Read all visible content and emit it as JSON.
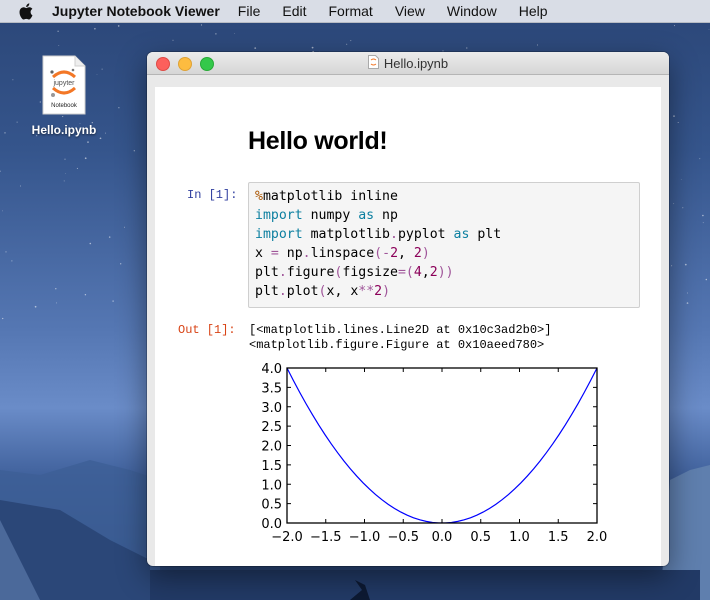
{
  "menubar": {
    "apple_icon": "apple-logo-icon",
    "app_name": "Jupyter Notebook Viewer",
    "items": [
      "File",
      "Edit",
      "Format",
      "View",
      "Window",
      "Help"
    ]
  },
  "desktop": {
    "icon": {
      "icon_name": "jupyter-notebook-file-icon",
      "logo_text": "jupyter",
      "badge_text": "Notebook",
      "label": "Hello.ipynb"
    }
  },
  "window": {
    "title": "Hello.ipynb",
    "title_icon": "notebook-document-icon",
    "colors": {
      "close": "#fc605c",
      "minimize": "#fdbc40",
      "maximize": "#34c84a"
    }
  },
  "notebook": {
    "heading": "Hello world!",
    "cells": [
      {
        "in_prompt": "In [1]:",
        "code_lines": [
          [
            [
              "m",
              "%"
            ],
            [
              "",
              "matplotlib inline"
            ]
          ],
          [
            [
              "k",
              "import"
            ],
            [
              "",
              " numpy "
            ],
            [
              "k",
              "as"
            ],
            [
              "",
              " np"
            ]
          ],
          [
            [
              "k",
              "import"
            ],
            [
              "",
              " matplotlib"
            ],
            [
              "o",
              "."
            ],
            [
              "",
              "pyplot "
            ],
            [
              "k",
              "as"
            ],
            [
              "",
              " plt"
            ]
          ],
          [
            [
              "",
              "x "
            ],
            [
              "o",
              "="
            ],
            [
              "",
              " np"
            ],
            [
              "o",
              "."
            ],
            [
              "",
              "linspace"
            ],
            [
              "o",
              "("
            ],
            [
              "o",
              "-"
            ],
            [
              "n",
              "2"
            ],
            [
              "",
              ", "
            ],
            [
              "n",
              "2"
            ],
            [
              "o",
              ")"
            ]
          ],
          [
            [
              "",
              "plt"
            ],
            [
              "o",
              "."
            ],
            [
              "",
              "figure"
            ],
            [
              "o",
              "("
            ],
            [
              "",
              "figsize"
            ],
            [
              "o",
              "=("
            ],
            [
              "n",
              "4"
            ],
            [
              "",
              ","
            ],
            [
              "n",
              "2"
            ],
            [
              "o",
              "))"
            ]
          ],
          [
            [
              "",
              "plt"
            ],
            [
              "o",
              "."
            ],
            [
              "",
              "plot"
            ],
            [
              "o",
              "("
            ],
            [
              "",
              "x, x"
            ],
            [
              "o",
              "**"
            ],
            [
              "n",
              "2"
            ],
            [
              "o",
              ")"
            ]
          ]
        ],
        "out_prompt": "Out [1]:",
        "out_text": "[<matplotlib.lines.Line2D at 0x10c3ad2b0>]\n<matplotlib.figure.Figure at 0x10aeed780>"
      }
    ]
  },
  "chart_data": {
    "type": "line",
    "title": "",
    "xlabel": "",
    "ylabel": "",
    "xlim": [
      -2.0,
      2.0
    ],
    "ylim": [
      0.0,
      4.0
    ],
    "grid": false,
    "x_ticks": [
      "−2.0",
      "−1.5",
      "−1.0",
      "−0.5",
      "0.0",
      "0.5",
      "1.0",
      "1.5",
      "2.0"
    ],
    "x_tick_values": [
      -2.0,
      -1.5,
      -1.0,
      -0.5,
      0.0,
      0.5,
      1.0,
      1.5,
      2.0
    ],
    "y_ticks": [
      "0.0",
      "0.5",
      "1.0",
      "1.5",
      "2.0",
      "2.5",
      "3.0",
      "3.5",
      "4.0"
    ],
    "y_tick_values": [
      0.0,
      0.5,
      1.0,
      1.5,
      2.0,
      2.5,
      3.0,
      3.5,
      4.0
    ],
    "series": [
      {
        "name": "x**2",
        "color": "#0000ff",
        "function": "y = x^2",
        "x_range": [
          -2,
          2
        ],
        "num_points": 50
      }
    ]
  }
}
